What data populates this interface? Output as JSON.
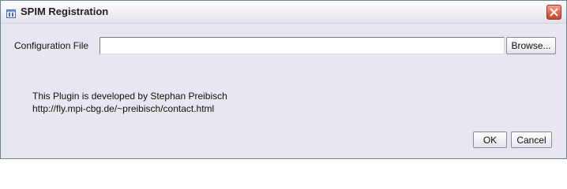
{
  "window": {
    "title": "SPIM Registration",
    "title_icon": "java-app-icon",
    "close_icon": "close-icon"
  },
  "form": {
    "config_label": "Configuration File",
    "config_value": "",
    "browse_label": "Browse..."
  },
  "credits": {
    "line1": "This Plugin is developed by Stephan Preibisch",
    "line2": "http://fly.mpi-cbg.de/~preibisch/contact.html"
  },
  "actions": {
    "ok_label": "OK",
    "cancel_label": "Cancel"
  },
  "colors": {
    "dialog_background": "#e8e6ee",
    "close_button": "#d9553a"
  }
}
